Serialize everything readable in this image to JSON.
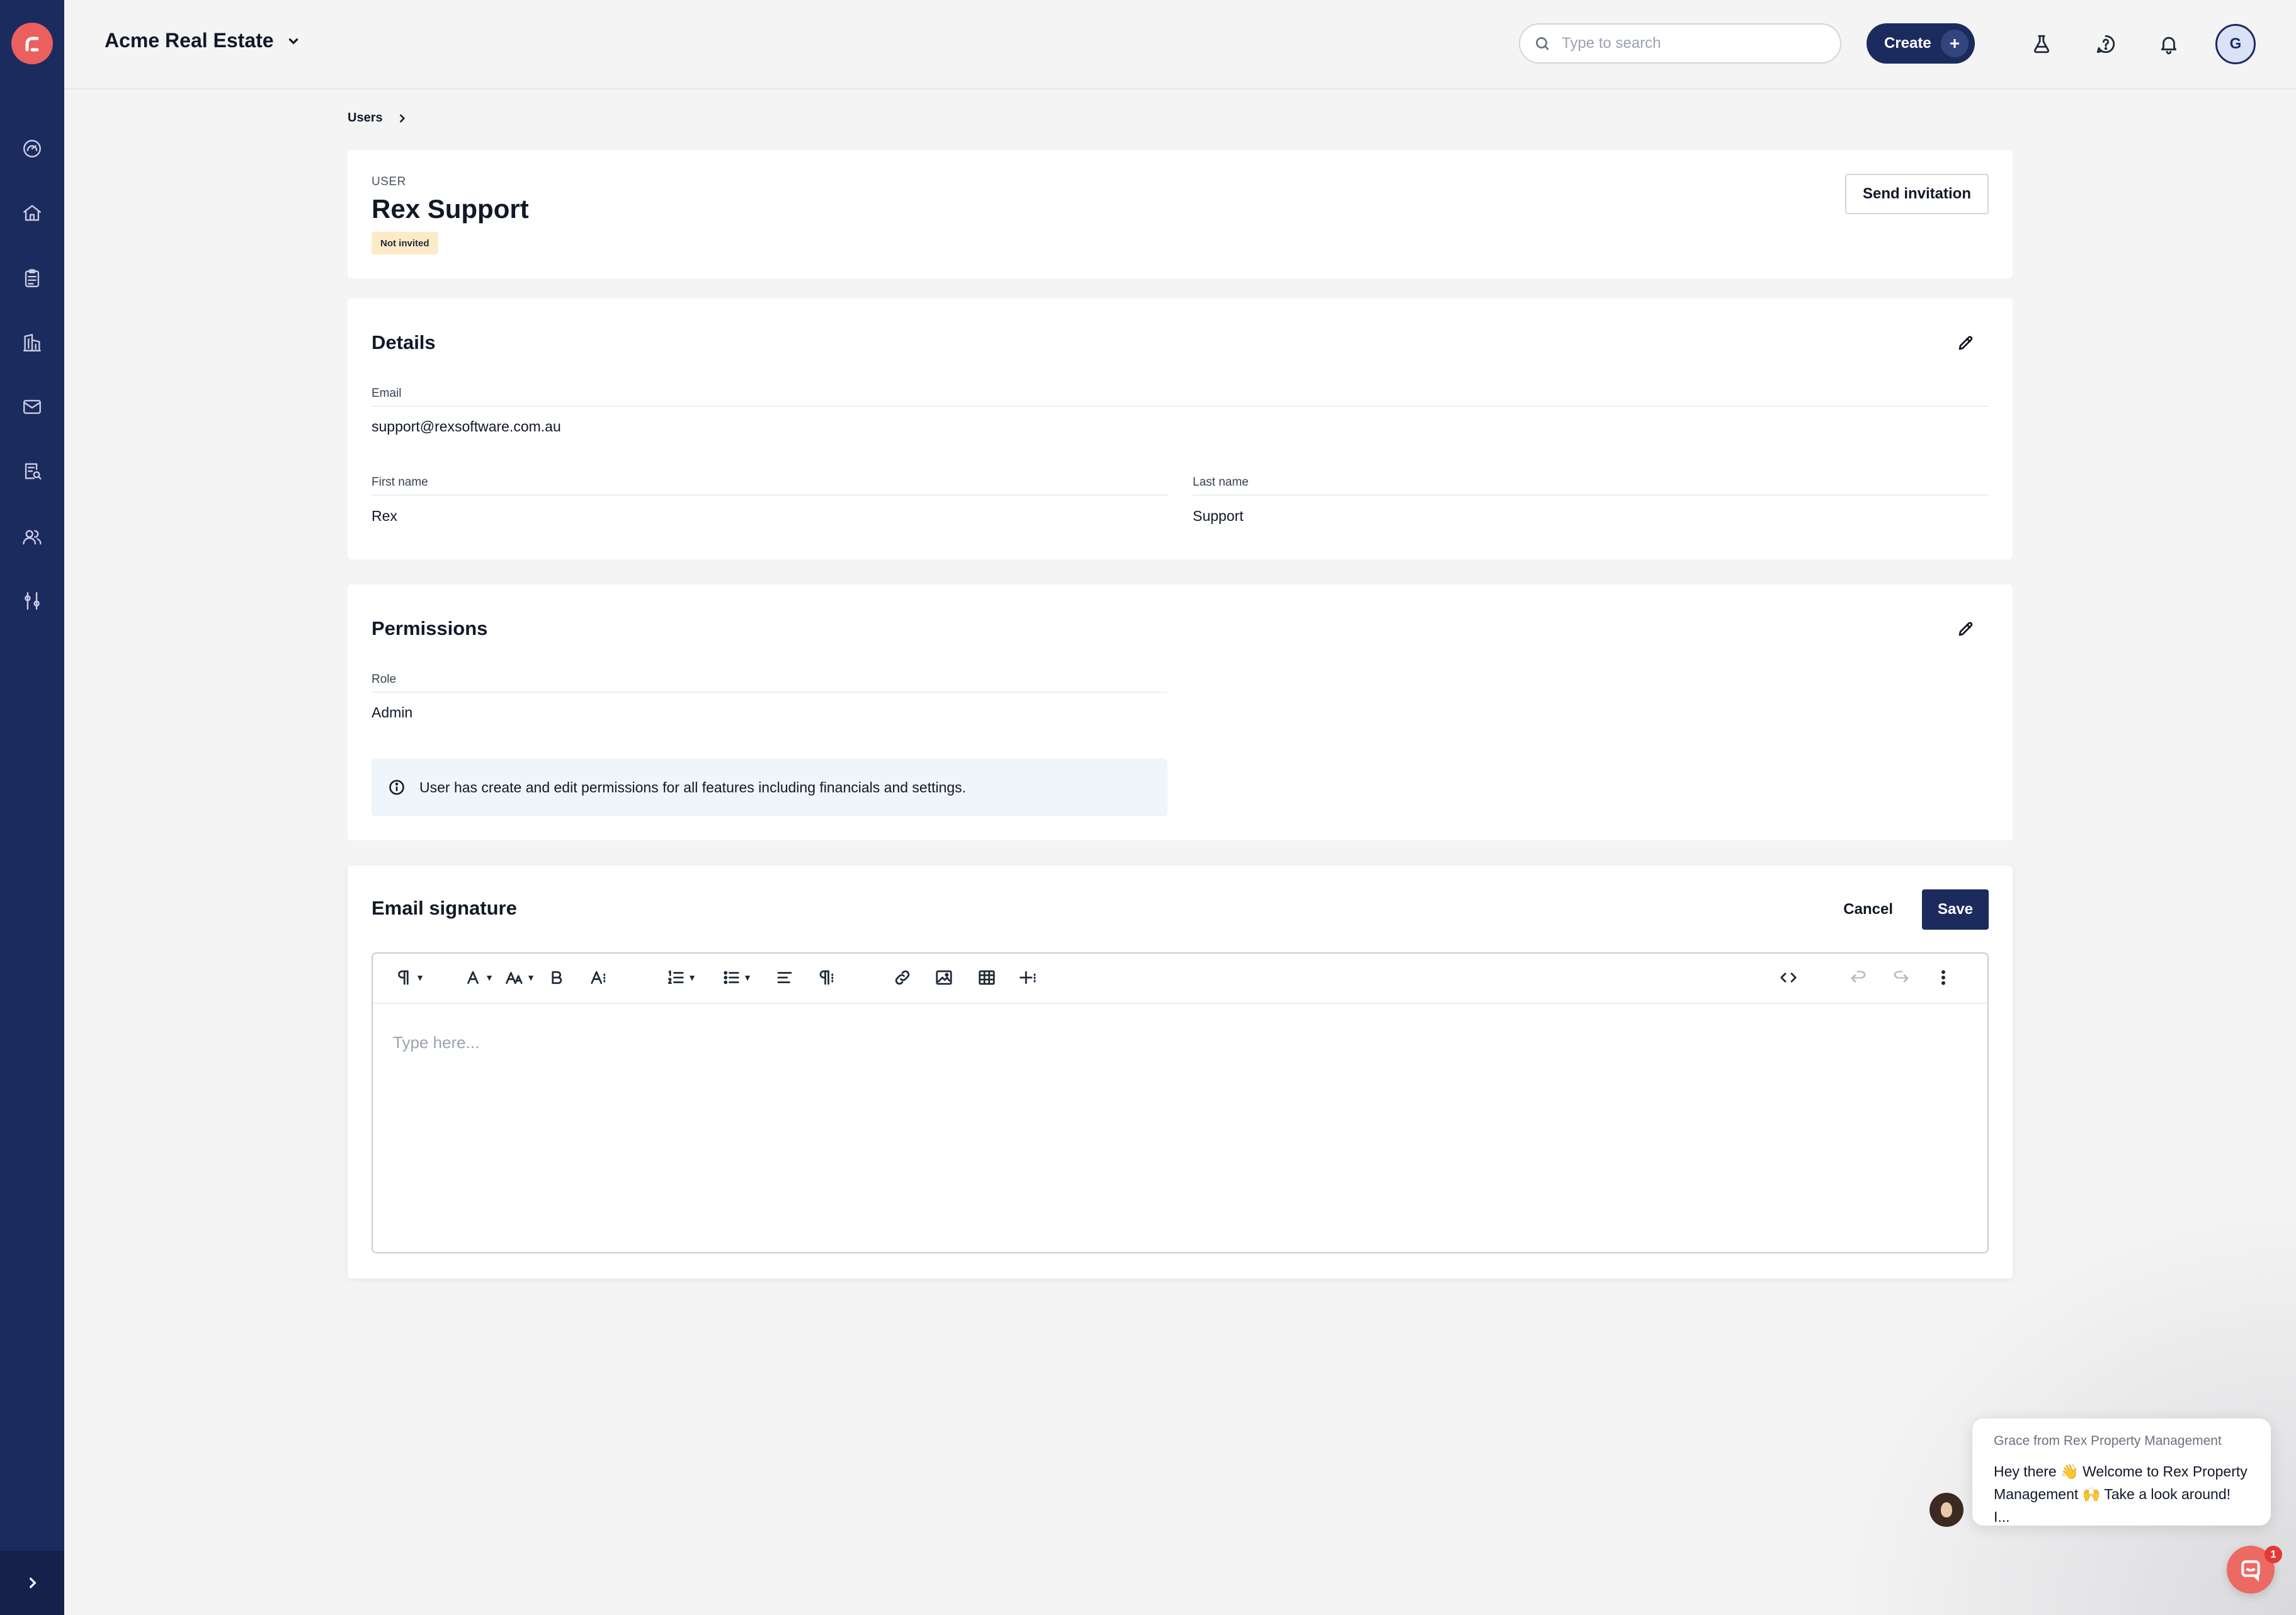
{
  "header": {
    "account_name": "Acme Real Estate",
    "search_placeholder": "Type to search",
    "create_label": "Create",
    "avatar_initial": "G"
  },
  "sidebar": {
    "items": [
      {
        "icon": "dashboard-icon"
      },
      {
        "icon": "home-icon"
      },
      {
        "icon": "clipboard-icon"
      },
      {
        "icon": "building-icon"
      },
      {
        "icon": "mail-icon"
      },
      {
        "icon": "report-search-icon"
      },
      {
        "icon": "users-icon"
      },
      {
        "icon": "settings-sliders-icon"
      }
    ]
  },
  "breadcrumb": {
    "parent": "Users"
  },
  "user": {
    "type_label": "USER",
    "name": "Rex Support",
    "status": "Not invited",
    "send_invitation_label": "Send invitation"
  },
  "details": {
    "title": "Details",
    "email_label": "Email",
    "email": "support@rexsoftware.com.au",
    "first_name_label": "First name",
    "first_name": "Rex",
    "last_name_label": "Last name",
    "last_name": "Support"
  },
  "permissions": {
    "title": "Permissions",
    "role_label": "Role",
    "role": "Admin",
    "info": "User has create and edit permissions for all features including financials and settings."
  },
  "signature": {
    "title": "Email signature",
    "cancel_label": "Cancel",
    "save_label": "Save",
    "placeholder": "Type here..."
  },
  "chat": {
    "from": "Grace from Rex Property Management",
    "message_line1": "Hey there 👋 Welcome to Rex Property",
    "message_line2": "Management 🙌 Take a look around! I...",
    "badge_count": "1"
  },
  "colors": {
    "sidebar": "#1c2b5e",
    "brand": "#ec5f5f",
    "primary_button": "#1c2b5e",
    "badge_bg": "#fdebc8",
    "info_bg": "#eef5fb"
  }
}
